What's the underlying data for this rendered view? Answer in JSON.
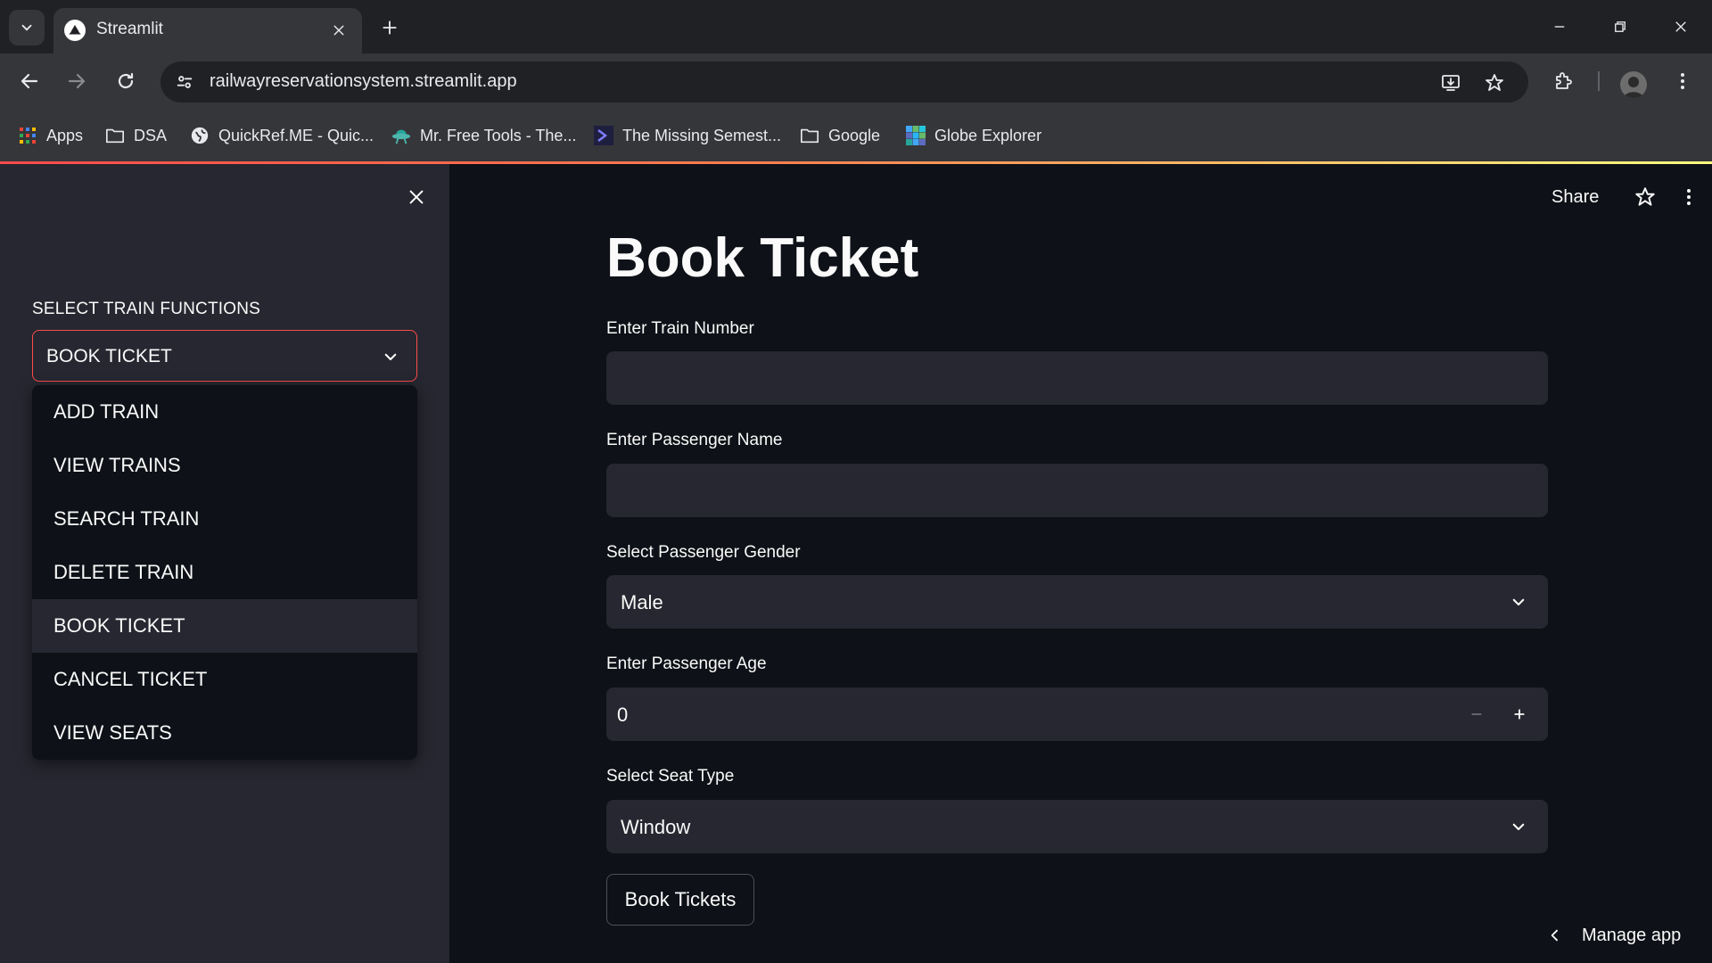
{
  "browser": {
    "tab": {
      "title": "Streamlit"
    },
    "url": "railwayreservationsystem.streamlit.app",
    "bookmarks": [
      {
        "label": "Apps",
        "icon": "apps-grid-icon"
      },
      {
        "label": "DSA",
        "icon": "folder-icon"
      },
      {
        "label": "QuickRef.ME - Quic...",
        "icon": "globe-icon"
      },
      {
        "label": "Mr. Free Tools - The...",
        "icon": "ufo-icon"
      },
      {
        "label": "The Missing Semest...",
        "icon": "terminal-icon"
      },
      {
        "label": "Google",
        "icon": "folder-icon"
      },
      {
        "label": "Globe Explorer",
        "icon": "globe-explorer-icon"
      }
    ]
  },
  "sidebar": {
    "label": "SELECT TRAIN FUNCTIONS",
    "selected": "BOOK TICKET",
    "options": [
      "ADD TRAIN",
      "VIEW TRAINS",
      "SEARCH TRAIN",
      "DELETE TRAIN",
      "BOOK TICKET",
      "CANCEL TICKET",
      "VIEW SEATS"
    ]
  },
  "header": {
    "share": "Share"
  },
  "main": {
    "title": "Book Ticket",
    "train_number": {
      "label": "Enter Train Number",
      "value": ""
    },
    "passenger_name": {
      "label": "Enter Passenger Name",
      "value": ""
    },
    "gender": {
      "label": "Select Passenger Gender",
      "value": "Male"
    },
    "age": {
      "label": "Enter Passenger Age",
      "value": "0"
    },
    "seat_type": {
      "label": "Select Seat Type",
      "value": "Window"
    },
    "button": "Book Tickets"
  },
  "footer": {
    "manage_app": "Manage app"
  },
  "colors": {
    "app_bg": "#0e1117",
    "sidebar_bg": "#262730",
    "input_bg": "#262730",
    "accent": "#ff4b4b",
    "text": "#fafafa"
  }
}
